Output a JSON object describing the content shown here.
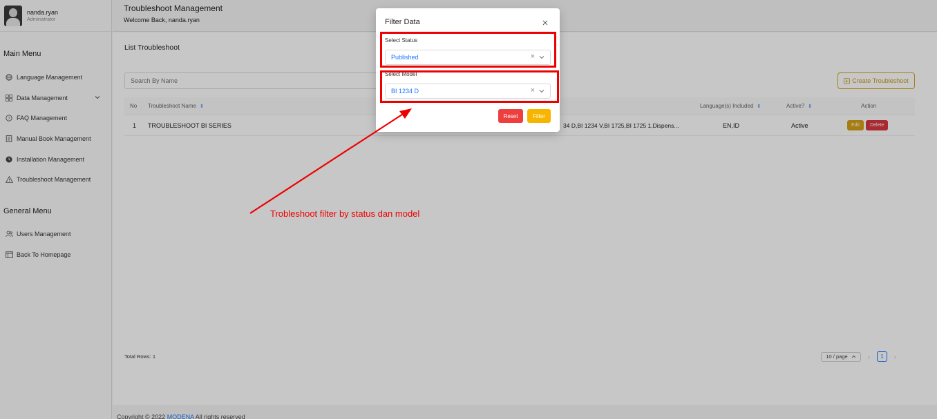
{
  "profile": {
    "username": "nanda.ryan",
    "role": "Administrator"
  },
  "sidebar": {
    "main_menu_heading": "Main Menu",
    "main_items": [
      {
        "label": "Language Management",
        "icon": "globe-icon"
      },
      {
        "label": "Data Management",
        "icon": "grid-icon"
      },
      {
        "label": "FAQ Management",
        "icon": "question-icon"
      },
      {
        "label": "Manual Book Management",
        "icon": "book-icon"
      },
      {
        "label": "Installation Management",
        "icon": "clock-icon"
      },
      {
        "label": "Troubleshoot Management",
        "icon": "warning-icon"
      }
    ],
    "general_menu_heading": "General Menu",
    "general_items": [
      {
        "label": "Users Management",
        "icon": "users-icon"
      },
      {
        "label": "Back To Homepage",
        "icon": "window-icon"
      }
    ]
  },
  "header": {
    "title": "Troubleshoot Management",
    "subtitle": "Welcome Back, nanda.ryan"
  },
  "card": {
    "title": "List Troubleshoot",
    "search_placeholder": "Search By Name",
    "create_button": "Create Troubleshoot"
  },
  "table": {
    "headers": {
      "no": "No",
      "name": "Troubleshoot Name",
      "languages": "Language(s) Included",
      "active": "Active?",
      "action": "Action"
    },
    "rows": [
      {
        "no": "1",
        "name": "TROUBLESHOOT BI SERIES",
        "models": "34 D,BI 1234 V,BI 1725,BI 1725 1,Dispens...",
        "languages": "EN,ID",
        "active": "Active",
        "edit": "Edit",
        "delete": "Delete"
      }
    ]
  },
  "pagination": {
    "total": "Total Rows: 1",
    "page_size": "10 / page",
    "current_page": "1"
  },
  "footer": {
    "prefix": "Copyright © 2022",
    "brand": "MODENA",
    "suffix": "All rights reserved"
  },
  "modal": {
    "title": "Filter Data",
    "status_label": "Select Status",
    "status_value": "Published",
    "model_label": "Select Model",
    "model_value": "BI 1234 D",
    "reset_button": "Reset",
    "filter_button": "Filter"
  },
  "annotation": "Trobleshoot filter by status dan model",
  "colors": {
    "accent": "#1677ff",
    "warning": "#d4a017",
    "danger": "#d9363e",
    "annotation": "#ee0000"
  }
}
